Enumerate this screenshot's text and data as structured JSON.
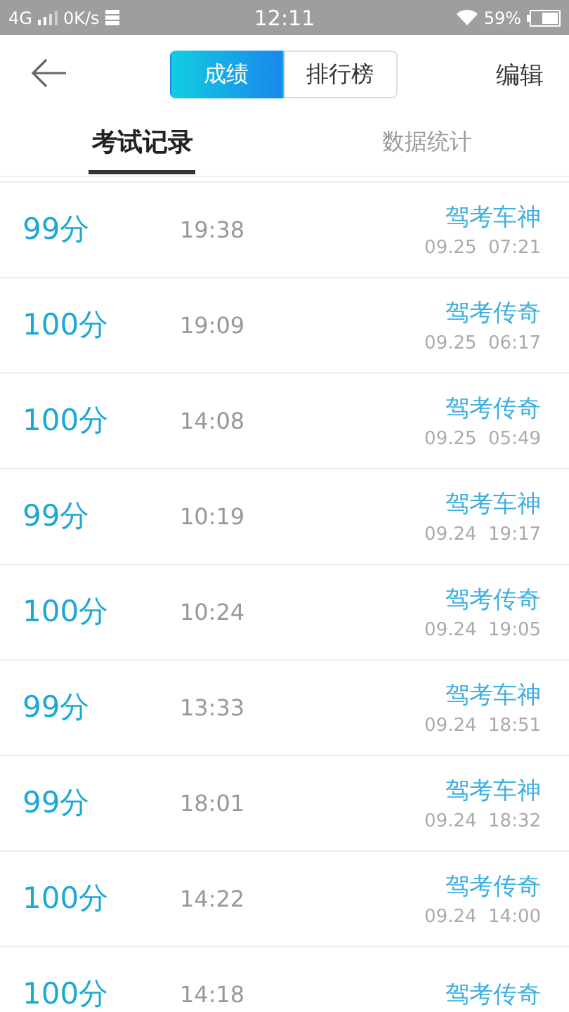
{
  "status_bar": {
    "network": "4G",
    "speed": "0K/s",
    "time": "12:11",
    "battery": "59%"
  },
  "header": {
    "segments": [
      {
        "label": "成绩",
        "selected": true
      },
      {
        "label": "排行榜",
        "selected": false
      }
    ],
    "action": "编辑"
  },
  "tabs": [
    {
      "label": "考试记录",
      "selected": true
    },
    {
      "label": "数据统计",
      "selected": false
    }
  ],
  "records": [
    {
      "score": "99分",
      "duration": "19:38",
      "title": "驾考车神",
      "date": "09.25  07:21"
    },
    {
      "score": "100分",
      "duration": "19:09",
      "title": "驾考传奇",
      "date": "09.25  06:17"
    },
    {
      "score": "100分",
      "duration": "14:08",
      "title": "驾考传奇",
      "date": "09.25  05:49"
    },
    {
      "score": "99分",
      "duration": "10:19",
      "title": "驾考车神",
      "date": "09.24  19:17"
    },
    {
      "score": "100分",
      "duration": "10:24",
      "title": "驾考传奇",
      "date": "09.24  19:05"
    },
    {
      "score": "99分",
      "duration": "13:33",
      "title": "驾考车神",
      "date": "09.24  18:51"
    },
    {
      "score": "99分",
      "duration": "18:01",
      "title": "驾考车神",
      "date": "09.24  18:32"
    },
    {
      "score": "100分",
      "duration": "14:22",
      "title": "驾考传奇",
      "date": "09.24  14:00"
    },
    {
      "score": "100分",
      "duration": "14:18",
      "title": "驾考传奇"
    }
  ]
}
